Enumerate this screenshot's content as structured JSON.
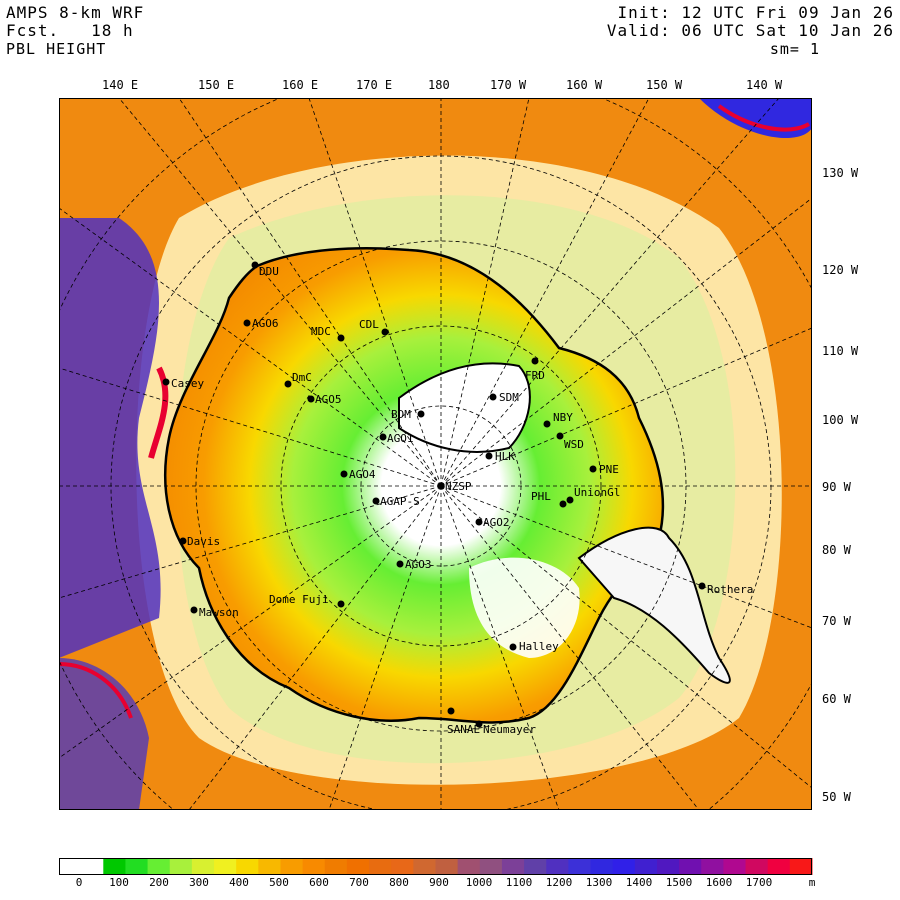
{
  "header": {
    "title": "AMPS 8-km WRF",
    "forecast_label": "Fcst.",
    "forecast_value": "18 h",
    "field": "PBL HEIGHT",
    "init": "Init: 12 UTC Fri 09 Jan 26",
    "valid": "Valid: 06 UTC Sat 10 Jan 26",
    "smoothing": "sm= 1"
  },
  "longitude_labels_top": [
    "140 E",
    "150 E",
    "160 E",
    "170 E",
    "180",
    "170 W",
    "160 W",
    "150 W",
    "140 W"
  ],
  "longitude_labels_right": [
    "130 W",
    "120 W",
    "110 W",
    "100 W",
    "90 W",
    "80 W",
    "70 W",
    "60 W",
    "50 W"
  ],
  "stations": [
    "DDU",
    "AGO6",
    "MDC",
    "CDL",
    "Casey",
    "DmC",
    "AGO5",
    "FRD",
    "SDM",
    "BDM",
    "NBY",
    "AGO1",
    "WSD",
    "HLK",
    "PNE",
    "AGO4",
    "NZSP",
    "PHL",
    "UnionGl",
    "AGAP-S",
    "AGO2",
    "AGO3",
    "Davis",
    "Dome Fuji",
    "Rothera",
    "Mawson",
    "Halley",
    "SANAE",
    "Neumayer"
  ],
  "colorbar": {
    "tick_labels": [
      "0",
      "100",
      "200",
      "300",
      "400",
      "500",
      "600",
      "700",
      "800",
      "900",
      "1000",
      "1100",
      "1200",
      "1300",
      "1400",
      "1500",
      "1600",
      "1700"
    ],
    "unit": "m",
    "colors": [
      "#ffffff",
      "#ffffff",
      "#00c800",
      "#22dd22",
      "#66ee33",
      "#a8f03c",
      "#d8f030",
      "#f0f020",
      "#f8d800",
      "#f8b800",
      "#f89c00",
      "#f88a00",
      "#f07c00",
      "#f07000",
      "#e86c10",
      "#e86818",
      "#d06830",
      "#c06040",
      "#a05070",
      "#905080",
      "#7c4098",
      "#6040a8",
      "#5030c0",
      "#3c30d8",
      "#3028e0",
      "#3020e8",
      "#4020d0",
      "#5018c0",
      "#7010b0",
      "#9010a0",
      "#b00890",
      "#d00860",
      "#f00040",
      "#f81818"
    ]
  }
}
